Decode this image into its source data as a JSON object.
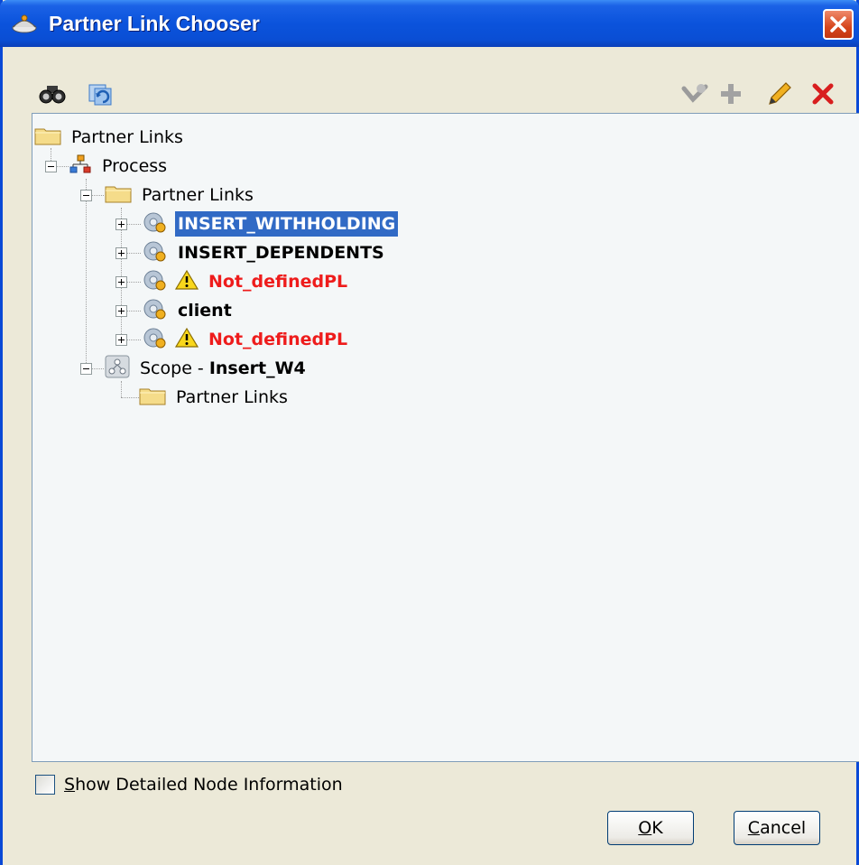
{
  "window": {
    "title": "Partner Link Chooser"
  },
  "toolbar": {
    "left": [
      "search-icon",
      "refresh-icon"
    ],
    "right": [
      "view-icon",
      "add-icon",
      "edit-icon",
      "delete-icon"
    ]
  },
  "tree": {
    "root_label": "Partner Links",
    "process_label": "Process",
    "partner_links_label": "Partner Links",
    "items": [
      {
        "label": "INSERT_WITHHOLDING",
        "selected": true,
        "warning": false
      },
      {
        "label": "INSERT_DEPENDENTS",
        "selected": false,
        "warning": false
      },
      {
        "label": "Not_definedPL",
        "selected": false,
        "warning": true
      },
      {
        "label": "client",
        "selected": false,
        "warning": false
      },
      {
        "label": "Not_definedPL",
        "selected": false,
        "warning": true
      }
    ],
    "scope_prefix": "Scope - ",
    "scope_name": "Insert_W4",
    "scope_partner_links_label": "Partner Links"
  },
  "options": {
    "show_details_mnemonic": "S",
    "show_details_rest": "how Detailed Node Information",
    "show_details_checked": false
  },
  "buttons": {
    "ok_mnemonic": "O",
    "ok_rest": "K",
    "cancel_mnemonic": "C",
    "cancel_rest": "ancel"
  },
  "colors": {
    "title_bar": "#0b53dc",
    "selection": "#316ac5",
    "warning_text": "#ee1c1c"
  }
}
